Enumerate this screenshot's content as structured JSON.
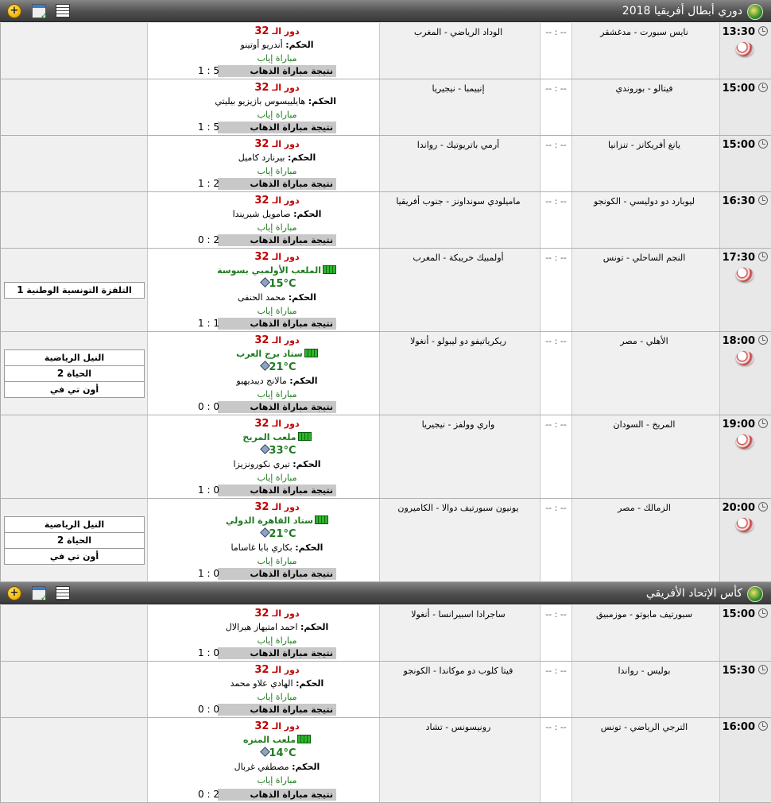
{
  "sections": [
    {
      "title": "دوري أبطال أفريقيا",
      "year": "2018",
      "matches": [
        {
          "time": "13:30",
          "ball": true,
          "home": "نايس سبورت - مدغشقر",
          "score": "-- : --",
          "away": "الوداد الرياضي - المغرب",
          "round_label": "دور الـ",
          "round_num": "32",
          "referee_label": "الحكم:",
          "referee": "أندريو أوتينو",
          "leg": "مباراة إياب",
          "result_label": "نتيجة مباراة الذهاب",
          "agg_away": "1",
          "agg_home": "5",
          "tv": []
        },
        {
          "time": "15:00",
          "ball": false,
          "home": "فيتالو - بوروندي",
          "score": "-- : --",
          "away": "إنييمبا - نيجيريا",
          "round_label": "دور الـ",
          "round_num": "32",
          "referee_label": "الحكم:",
          "referee": "هايلييسوس بازيزيو بيليتي",
          "leg": "مباراة إياب",
          "result_label": "نتيجة مباراة الذهاب",
          "agg_away": "1",
          "agg_home": "5",
          "tv": []
        },
        {
          "time": "15:00",
          "ball": false,
          "home": "يانغ أفريكانز - تنزانيا",
          "score": "-- : --",
          "away": "أرمي باتريوتيك - رواندا",
          "round_label": "دور الـ",
          "round_num": "32",
          "referee_label": "الحكم:",
          "referee": "بيرنارد كاميل",
          "leg": "مباراة إياب",
          "result_label": "نتيجة مباراة الذهاب",
          "agg_away": "1",
          "agg_home": "2",
          "tv": []
        },
        {
          "time": "16:30",
          "ball": false,
          "home": "ليوبارد دو دوليسي - الكونجو",
          "score": "-- : --",
          "away": "ماميلودي سونداونز - جنوب أفريقيا",
          "round_label": "دور الـ",
          "round_num": "32",
          "referee_label": "الحكم:",
          "referee": "صامويل شيريندا",
          "leg": "مباراة إياب",
          "result_label": "نتيجة مباراة الذهاب",
          "agg_away": "0",
          "agg_home": "2",
          "tv": []
        },
        {
          "time": "17:30",
          "ball": true,
          "home": "النجم الساحلي - تونس",
          "score": "-- : --",
          "away": "أولمبيك خريبكة - المغرب",
          "round_label": "دور الـ",
          "round_num": "32",
          "stadium": "الملعب الأولمبي بسوسة",
          "temp": "15°C",
          "referee_label": "الحكم:",
          "referee": "محمد الحنفى",
          "leg": "مباراة إياب",
          "result_label": "نتيجة مباراة الذهاب",
          "agg_away": "1",
          "agg_home": "1",
          "tv": [
            {
              "name": "التلفزة التونسية الوطنية",
              "num": "1"
            }
          ]
        },
        {
          "time": "18:00",
          "ball": true,
          "home": "الأهلي - مصر",
          "score": "-- : --",
          "away": "ريكرياتيفو دو ليبولو - أنغولا",
          "round_label": "دور الـ",
          "round_num": "32",
          "stadium": "ستاد برج العرب",
          "temp": "21°C",
          "referee_label": "الحكم:",
          "referee": "مالانج ديبديهيو",
          "leg": "مباراة إياب",
          "result_label": "نتيجة مباراة الذهاب",
          "agg_away": "0",
          "agg_home": "0",
          "tv": [
            {
              "name": "النيل الرياضية",
              "num": ""
            },
            {
              "name": "الحياة",
              "num": "2"
            },
            {
              "name": "أون تي في",
              "num": ""
            }
          ]
        },
        {
          "time": "19:00",
          "ball": true,
          "home": "المريخ - السودان",
          "score": "-- : --",
          "away": "واري وولفز - نيجيريا",
          "round_label": "دور الـ",
          "round_num": "32",
          "stadium": "ملعب المريخ",
          "temp": "33°C",
          "referee_label": "الحكم:",
          "referee": "تيري نكورونزيزا",
          "leg": "مباراة إياب",
          "result_label": "نتيجة مباراة الذهاب",
          "agg_away": "1",
          "agg_home": "0",
          "tv": []
        },
        {
          "time": "20:00",
          "ball": true,
          "home": "الزمالك - مصر",
          "score": "-- : --",
          "away": "يونيون سبورتيف دوالا - الكاميرون",
          "round_label": "دور الـ",
          "round_num": "32",
          "stadium": "ستاد القاهرة الدولي",
          "temp": "21°C",
          "referee_label": "الحكم:",
          "referee": "بكاري بابا غاساما",
          "leg": "مباراة إياب",
          "result_label": "نتيجة مباراة الذهاب",
          "agg_away": "1",
          "agg_home": "0",
          "tv": [
            {
              "name": "النيل الرياضية",
              "num": ""
            },
            {
              "name": "الحياة",
              "num": "2"
            },
            {
              "name": "أون تي في",
              "num": ""
            }
          ]
        }
      ]
    },
    {
      "title": "كأس الإتحاد الأفريقي",
      "year": "",
      "matches": [
        {
          "time": "15:00",
          "ball": false,
          "home": "سبورتيف مابوتو - موزمبيق",
          "score": "-- : --",
          "away": "ساجرادا اسبيرانسا - أنغولا",
          "round_label": "دور الـ",
          "round_num": "32",
          "referee_label": "الحكم:",
          "referee": "احمد امتيهاز هيرالال",
          "leg": "مباراة إياب",
          "result_label": "نتيجة مباراة الذهاب",
          "agg_away": "1",
          "agg_home": "0",
          "tv": []
        },
        {
          "time": "15:30",
          "ball": false,
          "home": "بوليس - رواندا",
          "score": "-- : --",
          "away": "فيتا كلوب دو موكاندا - الكونجو",
          "round_label": "دور الـ",
          "round_num": "32",
          "referee_label": "الحكم:",
          "referee": "الهادي علاو محمد",
          "leg": "مباراة إياب",
          "result_label": "نتيجة مباراة الذهاب",
          "agg_away": "0",
          "agg_home": "0",
          "tv": []
        },
        {
          "time": "16:00",
          "ball": false,
          "home": "الترجي الرياضي - تونس",
          "score": "-- : --",
          "away": "رونيسونس - تشاد",
          "round_label": "دور الـ",
          "round_num": "32",
          "stadium": "ملعب المنزه",
          "temp": "14°C",
          "referee_label": "الحكم:",
          "referee": "مصطفي غربال",
          "leg": "مباراة إياب",
          "result_label": "نتيجة مباراة الذهاب",
          "agg_away": "0",
          "agg_home": "2",
          "tv": []
        }
      ]
    }
  ]
}
